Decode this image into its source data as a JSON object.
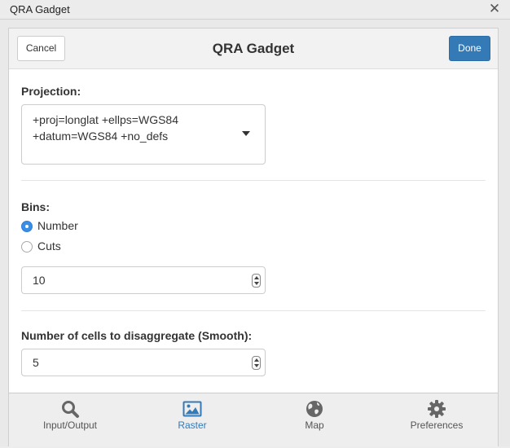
{
  "window": {
    "title": "QRA Gadget",
    "close_glyph": "✕"
  },
  "header": {
    "title": "QRA Gadget",
    "cancel_label": "Cancel",
    "done_label": "Done"
  },
  "projection": {
    "label": "Projection:",
    "value_line1": "+proj=longlat +ellps=WGS84",
    "value_line2": "+datum=WGS84 +no_defs"
  },
  "bins": {
    "label": "Bins:",
    "options": [
      {
        "label": "Number",
        "checked": true
      },
      {
        "label": "Cuts",
        "checked": false
      }
    ],
    "value": "10"
  },
  "smooth": {
    "label": "Number of cells to disaggregate (Smooth):",
    "value": "5"
  },
  "tabs": [
    {
      "label": "Input/Output",
      "icon": "search-icon",
      "active": false
    },
    {
      "label": "Raster",
      "icon": "image-icon",
      "active": true
    },
    {
      "label": "Map",
      "icon": "globe-icon",
      "active": false
    },
    {
      "label": "Preferences",
      "icon": "gear-icon",
      "active": false
    }
  ],
  "colors": {
    "accent": "#337ab7",
    "tab_icon": "#666666",
    "radio_checked": "#3a8ee6"
  }
}
